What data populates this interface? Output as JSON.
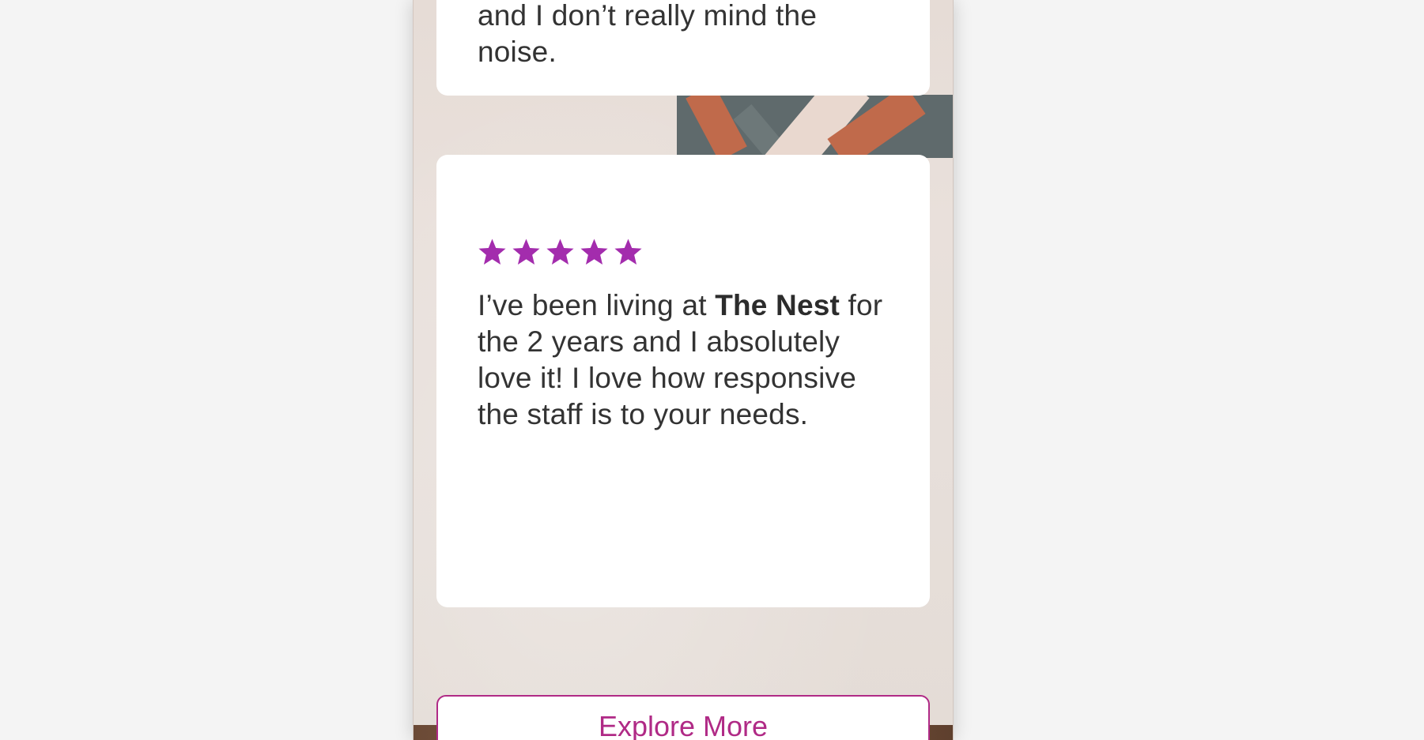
{
  "reviews": [
    {
      "text_parts": [
        "and I don’t really mind the noise."
      ]
    },
    {
      "stars": 5,
      "text_before": "I’ve been living at ",
      "text_bold": "The Nest",
      "text_after": " for the 2 years and I absolutely love it! I love how responsive the staff is to your needs."
    }
  ],
  "explore_button": {
    "label": "Explore More"
  },
  "colors": {
    "accent": "#b02a86",
    "star": "#a32cad",
    "text": "#333333"
  },
  "icons": {
    "rating": "star-icon"
  }
}
